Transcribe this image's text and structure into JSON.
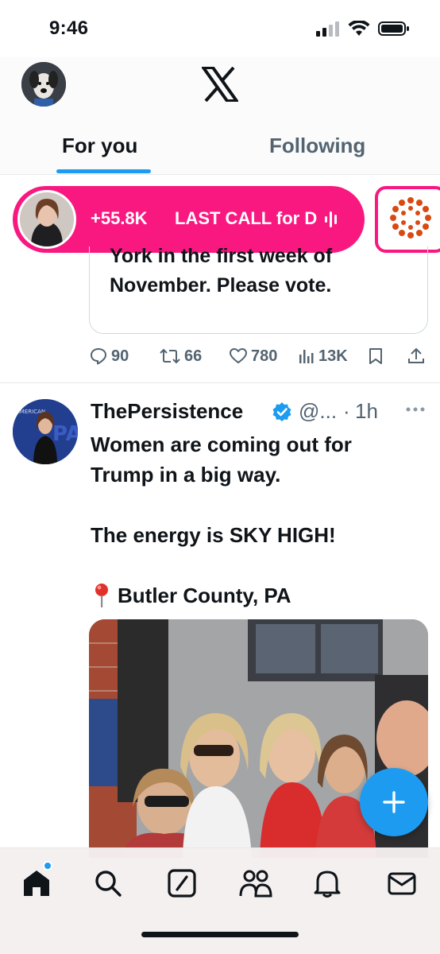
{
  "status_bar": {
    "time": "9:46"
  },
  "header": {
    "logo": "x-logo"
  },
  "tabs": [
    {
      "label": "For you",
      "selected": true
    },
    {
      "label": "Following",
      "selected": false
    }
  ],
  "live": {
    "count": "+55.8K",
    "title": "LAST CALL for D",
    "accent": "#f91880"
  },
  "quote": {
    "text_line1": "York in the first week of",
    "text_line2": "November. Please vote."
  },
  "actions": {
    "replies": "90",
    "reposts": "66",
    "likes": "780",
    "views": "13K"
  },
  "post": {
    "author": "ThePersistence",
    "handle": "@...",
    "separator": "·",
    "time": "1h",
    "line1": "Women are coming out for",
    "line2": "Trump in a big way.",
    "line3": "The energy is SKY HIGH!",
    "location": "Butler County, PA"
  },
  "nav": [
    "home-icon",
    "search-icon",
    "grok-icon",
    "communities-icon",
    "notifications-icon",
    "messages-icon"
  ],
  "colors": {
    "brand": "#1d9bf0",
    "live": "#f91880",
    "text": "#0f1419",
    "muted": "#536471"
  }
}
